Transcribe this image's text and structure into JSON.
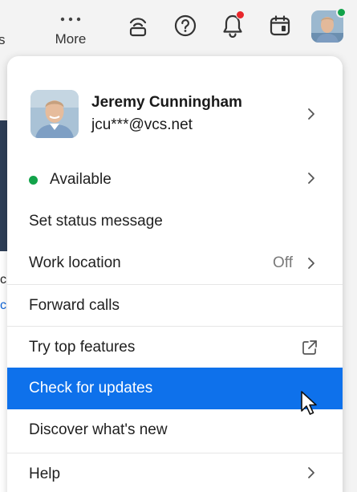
{
  "topbar": {
    "cut_label": "s",
    "more_label": "More",
    "icons": [
      "cast-icon",
      "help-icon",
      "bell-icon",
      "calendar-icon",
      "avatar"
    ]
  },
  "background": {
    "cut_text_1": "c",
    "cut_text_2": "c"
  },
  "profile": {
    "name": "Jeremy Cunningham",
    "email": "jcu***@vcs.net",
    "status_color": "#12a34a"
  },
  "menu": {
    "available": "Available",
    "set_status": "Set status message",
    "work_location": "Work location",
    "work_location_value": "Off",
    "forward_calls": "Forward calls",
    "try_features": "Try top features",
    "check_updates": "Check for updates",
    "discover": "Discover what's new",
    "help": "Help"
  },
  "colors": {
    "highlight": "#0e71eb",
    "available": "#12a34a",
    "notification": "#e8262b"
  }
}
